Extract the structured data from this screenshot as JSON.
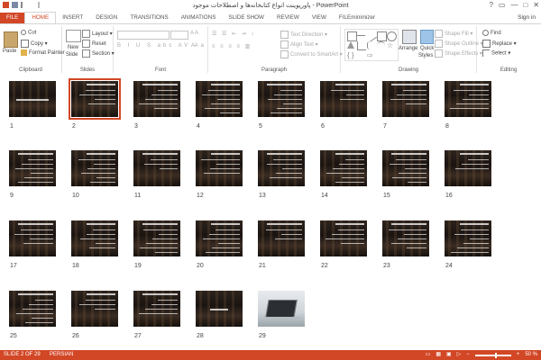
{
  "window": {
    "title": "پاورپوینت انواع کتابخانه‌ها و اصطلاحات موجود - PowerPoint",
    "controls": [
      "?",
      "▭",
      "—",
      "□",
      "✕"
    ]
  },
  "tabs": [
    "FILE",
    "HOME",
    "INSERT",
    "DESIGN",
    "TRANSITIONS",
    "ANIMATIONS",
    "SLIDE SHOW",
    "REVIEW",
    "VIEW",
    "FILEminimizer"
  ],
  "active_tab": "HOME",
  "signin": "Sign in",
  "ribbon": {
    "clipboard": {
      "label": "Clipboard",
      "paste": "Paste",
      "cut": "Cut",
      "copy": "Copy",
      "format_painter": "Format Painter"
    },
    "slides": {
      "label": "Slides",
      "new_slide": "New",
      "new_slide2": "Slide",
      "layout": "Layout",
      "reset": "Reset",
      "section": "Section"
    },
    "font": {
      "label": "Font"
    },
    "paragraph": {
      "label": "Paragraph",
      "text_direction": "Text Direction",
      "align_text": "Align Text",
      "convert": "Convert to SmartArt"
    },
    "drawing": {
      "label": "Drawing",
      "arrange": "Arrange",
      "quick_styles": "Quick",
      "quick_styles2": "Styles",
      "shape_fill": "Shape Fill",
      "shape_outline": "Shape Outline",
      "shape_effects": "Shape Effects"
    },
    "editing": {
      "label": "Editing",
      "find": "Find",
      "replace": "Replace",
      "select": "Select"
    }
  },
  "slides": [
    {
      "n": "1"
    },
    {
      "n": "2"
    },
    {
      "n": "3"
    },
    {
      "n": "4"
    },
    {
      "n": "5"
    },
    {
      "n": "6"
    },
    {
      "n": "7"
    },
    {
      "n": "8"
    },
    {
      "n": "9"
    },
    {
      "n": "10"
    },
    {
      "n": "11"
    },
    {
      "n": "12"
    },
    {
      "n": "13"
    },
    {
      "n": "14"
    },
    {
      "n": "15"
    },
    {
      "n": "16"
    },
    {
      "n": "17"
    },
    {
      "n": "18"
    },
    {
      "n": "19"
    },
    {
      "n": "20"
    },
    {
      "n": "21"
    },
    {
      "n": "22"
    },
    {
      "n": "23"
    },
    {
      "n": "24"
    },
    {
      "n": "25"
    },
    {
      "n": "26"
    },
    {
      "n": "27"
    },
    {
      "n": "28"
    },
    {
      "n": "29"
    }
  ],
  "selected_slide": 2,
  "status": {
    "slide_info": "SLIDE 2 OF 29",
    "language": "PERSIAN",
    "zoom": "50 %"
  },
  "colors": {
    "accent": "#d24726"
  }
}
